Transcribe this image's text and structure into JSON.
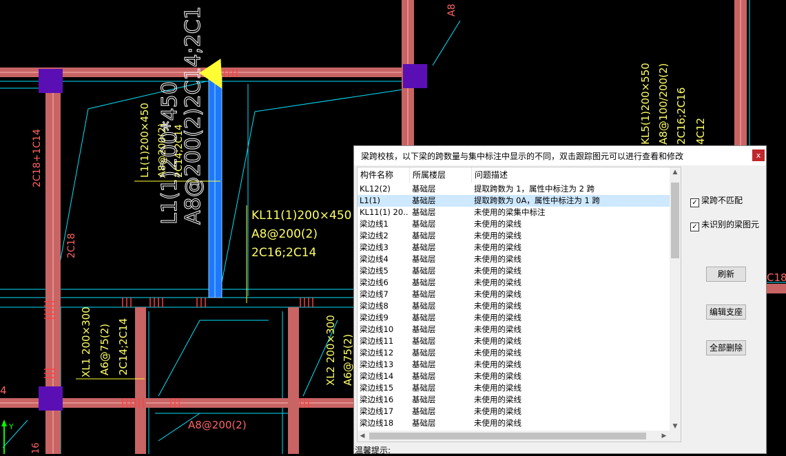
{
  "cad": {
    "labels": {
      "l1_vertical": "L1(1)200×450",
      "l1_vertical2": "A8@200(2)",
      "l1_vertical3": "2C14;2C14",
      "l1_big": "L1(1)200*450",
      "l1_big2": "A8@200(2)2C14;2C1",
      "kl11_1": "KL11(1)200×450",
      "kl11_2": "A8@200(2)",
      "kl11_3": "2C16;2C14",
      "left_col": "2C18+1C14",
      "left_col2": "2C18",
      "xl1_1": "XL1 200×300",
      "xl1_2": "A6@75(2)",
      "xl1_3": "2C14;2C14",
      "xl2_1": "XL2 200×300",
      "xl2_2": "A6@75(2)",
      "bottom": "A8@200(2)",
      "right_1": "KL5(1)200×550",
      "right_2": "A8@100/200(2)",
      "right_3": "2C16;2C16",
      "right_4": "4C12",
      "top_a8": "A8",
      "right_edge": "C18",
      "left_edge": "4",
      "bottom_left": "16",
      "axis_y": "Y"
    }
  },
  "dialog": {
    "title": "梁跨校核，以下梁的跨数量与集中标注中显示的不同，双击跟踪图元可以进行查看和修改",
    "close_label": "x",
    "columns": [
      "构件名称",
      "所属楼层",
      "问题描述"
    ],
    "rows": [
      {
        "name": "KL12(2)",
        "floor": "基础层",
        "desc": "提取跨数为 1，属性中标注为 2 跨",
        "selected": false
      },
      {
        "name": "L1(1)",
        "floor": "基础层",
        "desc": "提取跨数为 0A，属性中标注为 1 跨",
        "selected": true
      },
      {
        "name": "KL11(1) 20...",
        "floor": "基础层",
        "desc": "未使用的梁集中标注",
        "selected": false
      },
      {
        "name": "梁边线1",
        "floor": "基础层",
        "desc": "未使用的梁线",
        "selected": false
      },
      {
        "name": "梁边线2",
        "floor": "基础层",
        "desc": "未使用的梁线",
        "selected": false
      },
      {
        "name": "梁边线3",
        "floor": "基础层",
        "desc": "未使用的梁线",
        "selected": false
      },
      {
        "name": "梁边线4",
        "floor": "基础层",
        "desc": "未使用的梁线",
        "selected": false
      },
      {
        "name": "梁边线5",
        "floor": "基础层",
        "desc": "未使用的梁线",
        "selected": false
      },
      {
        "name": "梁边线6",
        "floor": "基础层",
        "desc": "未使用的梁线",
        "selected": false
      },
      {
        "name": "梁边线7",
        "floor": "基础层",
        "desc": "未使用的梁线",
        "selected": false
      },
      {
        "name": "梁边线8",
        "floor": "基础层",
        "desc": "未使用的梁线",
        "selected": false
      },
      {
        "name": "梁边线9",
        "floor": "基础层",
        "desc": "未使用的梁线",
        "selected": false
      },
      {
        "name": "梁边线10",
        "floor": "基础层",
        "desc": "未使用的梁线",
        "selected": false
      },
      {
        "name": "梁边线11",
        "floor": "基础层",
        "desc": "未使用的梁线",
        "selected": false
      },
      {
        "name": "梁边线12",
        "floor": "基础层",
        "desc": "未使用的梁线",
        "selected": false
      },
      {
        "name": "梁边线13",
        "floor": "基础层",
        "desc": "未使用的梁线",
        "selected": false
      },
      {
        "name": "梁边线14",
        "floor": "基础层",
        "desc": "未使用的梁线",
        "selected": false
      },
      {
        "name": "梁边线15",
        "floor": "基础层",
        "desc": "未使用的梁线",
        "selected": false
      },
      {
        "name": "梁边线16",
        "floor": "基础层",
        "desc": "未使用的梁线",
        "selected": false
      },
      {
        "name": "梁边线17",
        "floor": "基础层",
        "desc": "未使用的梁线",
        "selected": false
      },
      {
        "name": "梁边线18",
        "floor": "基础层",
        "desc": "未使用的梁线",
        "selected": false
      }
    ],
    "options": [
      {
        "label": "梁跨不匹配",
        "checked": true
      },
      {
        "label": "未识别的梁图元",
        "checked": true
      }
    ],
    "buttons": {
      "refresh": "刷新",
      "edit_support": "编辑支座",
      "delete_all": "全部删除"
    },
    "hint_label": "温馨提示:"
  },
  "colors": {
    "beam": "#c86464",
    "cyan": "#00e5ff",
    "label_yellow": "#ffff66",
    "label_red": "#ff6464",
    "column_purple": "#5a0fb4",
    "highlight_blue": "#1e78ff",
    "selection_row": "#cde8ff"
  }
}
